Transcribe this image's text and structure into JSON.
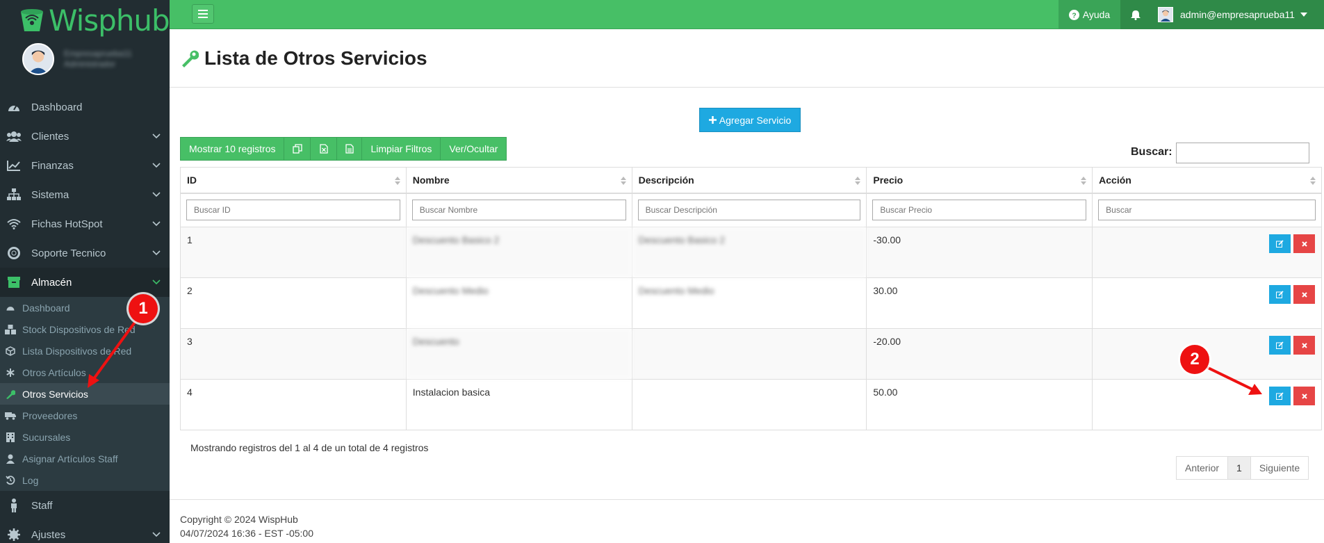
{
  "brand": {
    "name": "Wisphub"
  },
  "user_panel": {
    "name": "Empresaprueba11",
    "role": "Administrador"
  },
  "menu": [
    {
      "label": "Dashboard",
      "icon": "dashboard-icon"
    },
    {
      "label": "Clientes",
      "icon": "users-icon"
    },
    {
      "label": "Finanzas",
      "icon": "chart-line-icon"
    },
    {
      "label": "Sistema",
      "icon": "sitemap-icon"
    },
    {
      "label": "Fichas HotSpot",
      "icon": "wifi-icon"
    },
    {
      "label": "Soporte Tecnico",
      "icon": "lifebuoy-icon"
    },
    {
      "label": "Almacén",
      "icon": "archive-icon"
    },
    {
      "label": "Staff",
      "icon": "person-icon"
    },
    {
      "label": "Ajustes",
      "icon": "gear-icon"
    }
  ],
  "submenu": [
    {
      "label": "Dashboard",
      "icon": "dashboard-icon"
    },
    {
      "label": "Stock Dispositivos de Red",
      "icon": "cubes-icon"
    },
    {
      "label": "Lista Dispositivos de Red",
      "icon": "cube-icon"
    },
    {
      "label": "Otros Artículos",
      "icon": "asterisk-icon"
    },
    {
      "label": "Otros Servicios",
      "icon": "wrench-icon"
    },
    {
      "label": "Proveedores",
      "icon": "truck-icon"
    },
    {
      "label": "Sucursales",
      "icon": "building-icon"
    },
    {
      "label": "Asignar Artículos Staff",
      "icon": "user-icon"
    },
    {
      "label": "Log",
      "icon": "history-icon"
    }
  ],
  "navbar": {
    "help": "Ayuda",
    "user": "admin@empresaprueba11"
  },
  "page": {
    "title": "Lista de Otros Servicios"
  },
  "toolbar": {
    "add_service": "Agregar Servicio",
    "show_records": "Mostrar 10 registros",
    "clear_filters": "Limpiar Filtros",
    "toggle_columns": "Ver/Ocultar",
    "search_label": "Buscar:"
  },
  "table": {
    "columns": [
      "ID",
      "Nombre",
      "Descripción",
      "Precio",
      "Acción"
    ],
    "filters": [
      "Buscar ID",
      "Buscar Nombre",
      "Buscar Descripción",
      "Buscar Precio",
      "Buscar"
    ],
    "rows": [
      {
        "id": "1",
        "name": "Descuento Basico 2",
        "description": "Descuento Basico 2",
        "price": "-30.00"
      },
      {
        "id": "2",
        "name": "Descuento Medio",
        "description": "Descuento Medio",
        "price": "30.00"
      },
      {
        "id": "3",
        "name": "Descuento",
        "description": "",
        "price": "-20.00"
      },
      {
        "id": "4",
        "name": "Instalacion basica",
        "description": "",
        "price": "50.00"
      }
    ]
  },
  "info": "Mostrando registros del 1 al 4 de un total de 4 registros",
  "pagination": {
    "prev": "Anterior",
    "page": "1",
    "next": "Siguiente"
  },
  "footer": {
    "copyright": "Copyright © 2024 WispHub",
    "datetime": "04/07/2024 16:36 - EST -05:00"
  },
  "annotations": {
    "marker1": "1",
    "marker2": "2"
  },
  "colors": {
    "brand_green": "#47bf66",
    "sidebar": "#222d32",
    "primary_blue": "#1ea9e1",
    "danger_red": "#e64545",
    "annotation_red": "#ee1111"
  }
}
